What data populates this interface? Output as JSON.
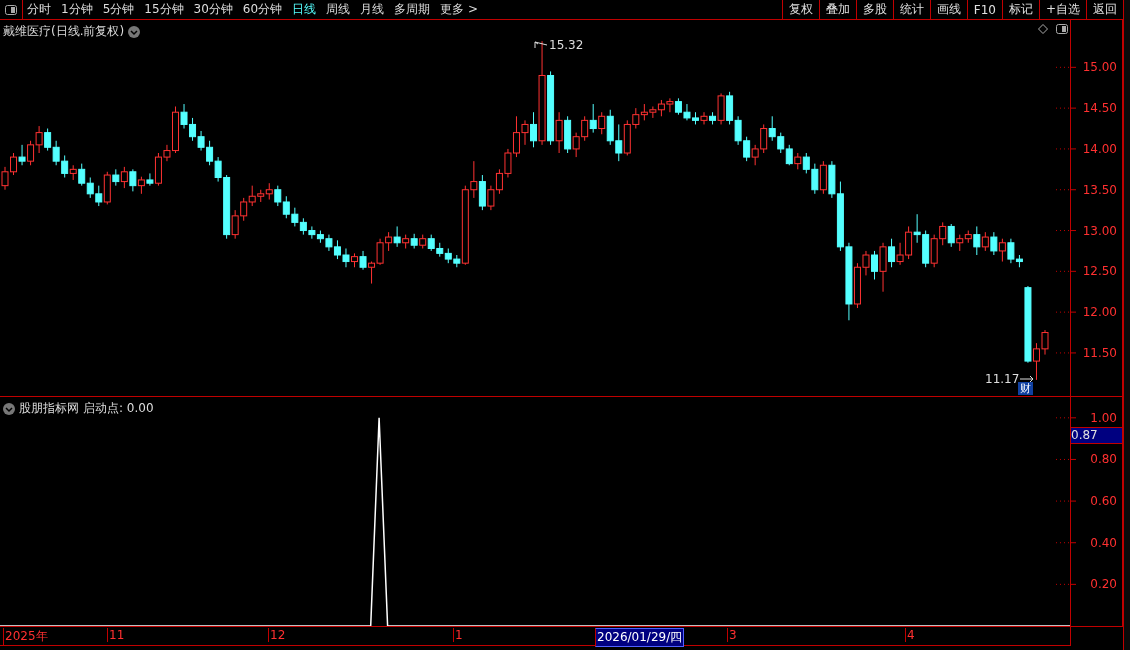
{
  "toolbar": {
    "periods": [
      {
        "label": "分时",
        "selected": false
      },
      {
        "label": "1分钟",
        "selected": false
      },
      {
        "label": "5分钟",
        "selected": false
      },
      {
        "label": "15分钟",
        "selected": false
      },
      {
        "label": "30分钟",
        "selected": false
      },
      {
        "label": "60分钟",
        "selected": false
      },
      {
        "label": "日线",
        "selected": true
      },
      {
        "label": "周线",
        "selected": false
      },
      {
        "label": "月线",
        "selected": false
      },
      {
        "label": "多周期",
        "selected": false
      },
      {
        "label": "更多 >",
        "selected": false
      }
    ],
    "buttons": [
      "复权",
      "叠加",
      "多股",
      "统计",
      "画线",
      "F10",
      "标记",
      "+自选",
      "返回"
    ]
  },
  "main_chart": {
    "title": "戴维医疗(日线.前复权)",
    "high_label": "15.32",
    "low_label": "11.17",
    "event_badge": "财",
    "chart_data": {
      "type": "candlestick",
      "ylim": [
        10.96,
        15.58
      ],
      "yticks": [
        {
          "value": 15,
          "label": "15.00"
        },
        {
          "value": 14.5,
          "label": "14.50"
        },
        {
          "value": 14,
          "label": "14.00"
        },
        {
          "value": 13.5,
          "label": "13.50"
        },
        {
          "value": 13,
          "label": "13.00"
        },
        {
          "value": 12.5,
          "label": "12.50"
        },
        {
          "value": 12,
          "label": "12.00"
        },
        {
          "value": 11.5,
          "label": "11.50"
        }
      ],
      "ohlc": [
        [
          13.55,
          13.78,
          13.5,
          13.72
        ],
        [
          13.72,
          13.95,
          13.68,
          13.9
        ],
        [
          13.9,
          14.05,
          13.8,
          13.85
        ],
        [
          13.85,
          14.1,
          13.8,
          14.05
        ],
        [
          14.05,
          14.28,
          13.95,
          14.2
        ],
        [
          14.2,
          14.25,
          13.98,
          14.02
        ],
        [
          14.02,
          14.1,
          13.8,
          13.85
        ],
        [
          13.85,
          13.92,
          13.65,
          13.7
        ],
        [
          13.7,
          13.8,
          13.62,
          13.75
        ],
        [
          13.75,
          13.82,
          13.55,
          13.58
        ],
        [
          13.58,
          13.65,
          13.4,
          13.45
        ],
        [
          13.45,
          13.55,
          13.3,
          13.35
        ],
        [
          13.35,
          13.72,
          13.32,
          13.68
        ],
        [
          13.68,
          13.75,
          13.55,
          13.6
        ],
        [
          13.6,
          13.78,
          13.52,
          13.72
        ],
        [
          13.72,
          13.75,
          13.48,
          13.55
        ],
        [
          13.55,
          13.66,
          13.45,
          13.62
        ],
        [
          13.62,
          13.7,
          13.55,
          13.58
        ],
        [
          13.58,
          13.95,
          13.55,
          13.9
        ],
        [
          13.9,
          14.05,
          13.85,
          13.98
        ],
        [
          13.98,
          14.52,
          13.95,
          14.45
        ],
        [
          14.45,
          14.55,
          14.25,
          14.3
        ],
        [
          14.3,
          14.38,
          14.1,
          14.15
        ],
        [
          14.15,
          14.22,
          13.98,
          14.02
        ],
        [
          14.02,
          14.1,
          13.8,
          13.85
        ],
        [
          13.85,
          13.9,
          13.6,
          13.65
        ],
        [
          13.65,
          13.68,
          12.9,
          12.95
        ],
        [
          12.95,
          13.25,
          12.9,
          13.18
        ],
        [
          13.18,
          13.4,
          13.12,
          13.35
        ],
        [
          13.35,
          13.55,
          13.3,
          13.42
        ],
        [
          13.42,
          13.5,
          13.35,
          13.45
        ],
        [
          13.45,
          13.58,
          13.38,
          13.5
        ],
        [
          13.5,
          13.55,
          13.3,
          13.35
        ],
        [
          13.35,
          13.42,
          13.15,
          13.2
        ],
        [
          13.2,
          13.28,
          13.05,
          13.1
        ],
        [
          13.1,
          13.15,
          12.95,
          13.0
        ],
        [
          13.0,
          13.05,
          12.9,
          12.95
        ],
        [
          12.95,
          13.0,
          12.85,
          12.9
        ],
        [
          12.9,
          12.95,
          12.75,
          12.8
        ],
        [
          12.8,
          12.88,
          12.65,
          12.7
        ],
        [
          12.7,
          12.78,
          12.55,
          12.62
        ],
        [
          12.62,
          12.72,
          12.55,
          12.68
        ],
        [
          12.68,
          12.75,
          12.52,
          12.55
        ],
        [
          12.55,
          12.62,
          12.35,
          12.6
        ],
        [
          12.6,
          12.9,
          12.58,
          12.85
        ],
        [
          12.85,
          12.98,
          12.75,
          12.92
        ],
        [
          12.92,
          13.05,
          12.8,
          12.85
        ],
        [
          12.85,
          12.95,
          12.78,
          12.9
        ],
        [
          12.9,
          12.96,
          12.78,
          12.82
        ],
        [
          12.82,
          12.95,
          12.78,
          12.9
        ],
        [
          12.9,
          12.95,
          12.75,
          12.78
        ],
        [
          12.78,
          12.85,
          12.68,
          12.72
        ],
        [
          12.72,
          12.78,
          12.6,
          12.65
        ],
        [
          12.65,
          12.7,
          12.55,
          12.6
        ],
        [
          12.6,
          13.55,
          12.58,
          13.5
        ],
        [
          13.5,
          13.85,
          13.4,
          13.6
        ],
        [
          13.6,
          13.68,
          13.25,
          13.3
        ],
        [
          13.3,
          13.55,
          13.25,
          13.5
        ],
        [
          13.5,
          13.75,
          13.45,
          13.7
        ],
        [
          13.7,
          14.0,
          13.65,
          13.95
        ],
        [
          13.95,
          14.4,
          13.9,
          14.2
        ],
        [
          14.2,
          14.35,
          14.05,
          14.3
        ],
        [
          14.3,
          14.45,
          14.02,
          14.1
        ],
        [
          14.1,
          15.32,
          14.05,
          14.9
        ],
        [
          14.9,
          14.95,
          14.05,
          14.1
        ],
        [
          14.1,
          14.45,
          13.95,
          14.35
        ],
        [
          14.35,
          14.4,
          13.95,
          14.0
        ],
        [
          14.0,
          14.2,
          13.9,
          14.15
        ],
        [
          14.15,
          14.4,
          14.1,
          14.35
        ],
        [
          14.35,
          14.55,
          14.2,
          14.25
        ],
        [
          14.25,
          14.45,
          14.18,
          14.4
        ],
        [
          14.4,
          14.48,
          14.05,
          14.1
        ],
        [
          14.1,
          14.3,
          13.85,
          13.95
        ],
        [
          13.95,
          14.35,
          13.92,
          14.3
        ],
        [
          14.3,
          14.5,
          14.25,
          14.42
        ],
        [
          14.42,
          14.55,
          14.35,
          14.45
        ],
        [
          14.45,
          14.52,
          14.38,
          14.48
        ],
        [
          14.48,
          14.6,
          14.4,
          14.55
        ],
        [
          14.55,
          14.62,
          14.45,
          14.58
        ],
        [
          14.58,
          14.62,
          14.42,
          14.45
        ],
        [
          14.45,
          14.55,
          14.35,
          14.38
        ],
        [
          14.38,
          14.45,
          14.3,
          14.35
        ],
        [
          14.35,
          14.45,
          14.3,
          14.4
        ],
        [
          14.4,
          14.45,
          14.3,
          14.35
        ],
        [
          14.35,
          14.68,
          14.3,
          14.65
        ],
        [
          14.65,
          14.7,
          14.3,
          14.35
        ],
        [
          14.35,
          14.4,
          14.05,
          14.1
        ],
        [
          14.1,
          14.15,
          13.85,
          13.9
        ],
        [
          13.9,
          14.05,
          13.8,
          14.0
        ],
        [
          14.0,
          14.3,
          13.95,
          14.25
        ],
        [
          14.25,
          14.4,
          14.1,
          14.15
        ],
        [
          14.15,
          14.2,
          13.95,
          14.0
        ],
        [
          14.0,
          14.05,
          13.8,
          13.82
        ],
        [
          13.82,
          13.95,
          13.75,
          13.9
        ],
        [
          13.9,
          13.95,
          13.7,
          13.75
        ],
        [
          13.75,
          13.82,
          13.45,
          13.5
        ],
        [
          13.5,
          13.85,
          13.45,
          13.8
        ],
        [
          13.8,
          13.85,
          13.4,
          13.45
        ],
        [
          13.45,
          13.6,
          12.75,
          12.8
        ],
        [
          12.8,
          12.85,
          11.9,
          12.1
        ],
        [
          12.1,
          12.6,
          12.05,
          12.55
        ],
        [
          12.55,
          12.75,
          12.45,
          12.7
        ],
        [
          12.7,
          12.75,
          12.4,
          12.5
        ],
        [
          12.5,
          12.85,
          12.25,
          12.8
        ],
        [
          12.8,
          12.9,
          12.55,
          12.62
        ],
        [
          12.62,
          12.85,
          12.58,
          12.7
        ],
        [
          12.7,
          13.05,
          12.65,
          12.98
        ],
        [
          12.98,
          13.2,
          12.85,
          12.95
        ],
        [
          12.95,
          13.0,
          12.55,
          12.6
        ],
        [
          12.6,
          12.95,
          12.55,
          12.9
        ],
        [
          12.9,
          13.1,
          12.82,
          13.05
        ],
        [
          13.05,
          13.08,
          12.8,
          12.85
        ],
        [
          12.85,
          12.95,
          12.75,
          12.9
        ],
        [
          12.9,
          13.0,
          12.85,
          12.95
        ],
        [
          12.95,
          13.05,
          12.7,
          12.8
        ],
        [
          12.8,
          12.98,
          12.75,
          12.92
        ],
        [
          12.92,
          12.98,
          12.7,
          12.75
        ],
        [
          12.75,
          12.9,
          12.62,
          12.85
        ],
        [
          12.85,
          12.9,
          12.6,
          12.65
        ],
        [
          12.65,
          12.7,
          12.55,
          12.62
        ],
        [
          12.3,
          12.32,
          11.38,
          11.4
        ],
        [
          11.4,
          11.62,
          11.17,
          11.55
        ],
        [
          11.55,
          11.78,
          11.48,
          11.75
        ]
      ]
    }
  },
  "indicator": {
    "title": "股朋指标网",
    "reading": "启动点: 0.00",
    "cursor_value": "0.87",
    "chart_data": {
      "type": "line",
      "ylim": [
        0,
        1.1
      ],
      "yticks": [
        {
          "value": 0.2,
          "label": "0.20"
        },
        {
          "value": 0.4,
          "label": "0.40"
        },
        {
          "value": 0.6,
          "label": "0.60"
        },
        {
          "value": 0.8,
          "label": "0.80"
        },
        {
          "value": 1,
          "label": "1.00"
        }
      ],
      "series": [
        {
          "color": "#ffffff",
          "values": [
            0,
            0,
            0,
            0,
            0,
            0,
            0,
            0,
            0,
            0,
            0,
            0,
            0,
            0,
            0,
            0,
            0,
            0,
            0,
            0,
            0,
            0,
            0,
            0,
            0,
            0,
            0,
            0,
            0,
            0,
            0,
            0,
            0,
            0,
            0,
            0,
            0,
            0,
            0,
            0,
            0,
            0,
            0,
            0,
            0,
            1,
            0,
            0,
            0,
            0,
            0,
            0,
            0,
            0,
            0,
            0,
            0,
            0,
            0,
            0,
            0,
            0,
            0,
            0,
            0,
            0,
            0,
            0,
            0,
            0,
            0,
            0,
            0,
            0,
            0,
            0,
            0,
            0,
            0,
            0,
            0,
            0,
            0,
            0,
            0,
            0,
            0,
            0,
            0,
            0,
            0,
            0,
            0,
            0,
            0,
            0,
            0,
            0,
            0,
            0,
            0,
            0,
            0,
            0,
            0,
            0,
            0,
            0,
            0,
            0,
            0,
            0,
            0,
            0,
            0,
            0,
            0,
            0,
            0,
            0,
            0,
            0,
            0,
            0,
            0,
            0,
            0,
            0
          ]
        }
      ]
    }
  },
  "date_axis": {
    "labels": [
      {
        "label": "2025年",
        "selected": false
      },
      {
        "label": "11",
        "selected": false
      },
      {
        "label": "12",
        "selected": false
      },
      {
        "label": "1",
        "selected": false
      },
      {
        "label": "2026/01/29/四",
        "selected": true
      },
      {
        "label": "3",
        "selected": false
      },
      {
        "label": "4",
        "selected": false
      }
    ]
  }
}
